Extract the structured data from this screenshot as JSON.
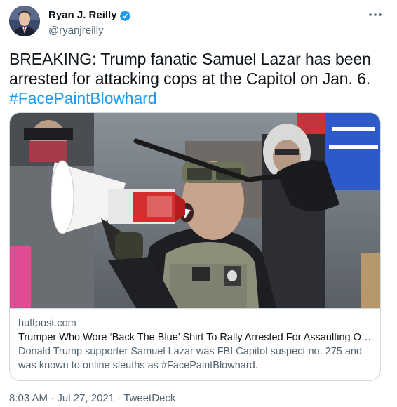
{
  "author": {
    "display_name": "Ryan J. Reilly",
    "handle": "@ryanjreilly",
    "verified": true,
    "verified_color": "#1d9bf0"
  },
  "tweet": {
    "text": "BREAKING: Trump fanatic Samuel Lazar has been arrested for attacking cops at the Capitol on Jan. 6.",
    "hashtag": "#FacePaintBlowhard",
    "hashtag_color": "#1d9bf0"
  },
  "card": {
    "domain": "huffpost.com",
    "title": "Trumper Who Wore ‘Back The Blue’ Shirt To Rally Arrested For Assaulting Offic…",
    "description": "Donald Trump supporter Samuel Lazar was FBI Capitol suspect no. 275 and was known to online sleuths as #FacePaintBlowhard."
  },
  "meta": {
    "time": "8:03 AM",
    "separator1": " · ",
    "date": "Jul 27, 2021",
    "separator2": " · ",
    "source": "TweetDeck"
  },
  "icons": {
    "avatar": "profile-photo",
    "verified": "verified-badge-icon",
    "more": "more-options-icon",
    "card_image": "megaphone-protester-photo"
  }
}
